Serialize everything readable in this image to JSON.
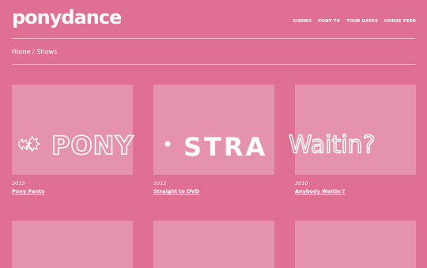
{
  "site": {
    "logo": "ponydance"
  },
  "nav": {
    "items": [
      "SHOWS",
      "PONY TV",
      "TOUR DATES",
      "HORSE FEED"
    ]
  },
  "breadcrumb": {
    "home": "Home",
    "separator": "/",
    "current": "Shows"
  },
  "shows": [
    {
      "year": "2012",
      "title": "Pony Panto",
      "art_text": "PONY"
    },
    {
      "year": "2012",
      "title": "Straight to DVD",
      "art_text": "STRA"
    },
    {
      "year": "2010",
      "title": "Anybody Waitin'?",
      "art_text": "Waitin?"
    }
  ],
  "colors": {
    "background": "#df6f93",
    "tile": "#e592ad",
    "text": "#ffffff"
  }
}
